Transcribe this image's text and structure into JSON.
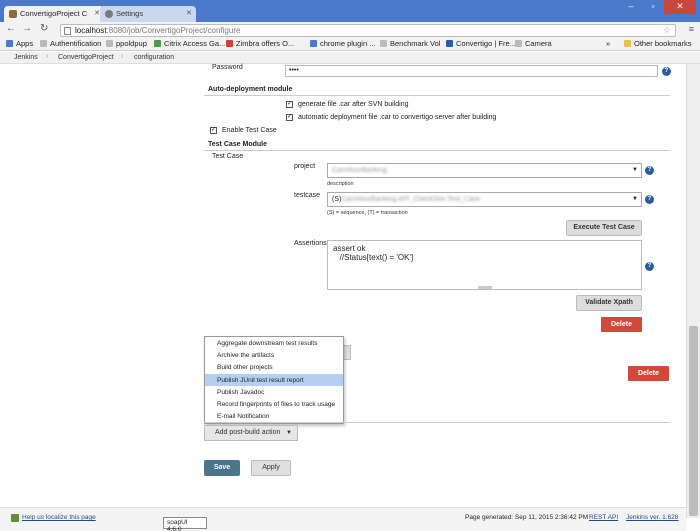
{
  "browser": {
    "tabs": [
      {
        "label": "ConvertigoProject C",
        "active": true
      },
      {
        "label": "Settings",
        "active": false
      }
    ],
    "address": {
      "host": "localhost",
      "path": ":8080/job/ConvertigoProject/configure"
    },
    "bookmarks": [
      {
        "label": "Apps",
        "color": "#4a7bd0"
      },
      {
        "label": "Authentification",
        "color": "#999999"
      },
      {
        "label": "ppoldpup",
        "color": "#999999"
      },
      {
        "label": "Citrix Access Ga...",
        "color": "#4b9a4b"
      },
      {
        "label": "Zimbra offers O...",
        "color": "#d04030"
      },
      {
        "label": "chrome plugin ...",
        "color": "#4a7bd0"
      },
      {
        "label": "Benchmark Vol",
        "color": "#999999"
      },
      {
        "label": "Convertigo | Fre...",
        "color": "#2a5ca8"
      },
      {
        "label": "Camera",
        "color": "#999999"
      }
    ],
    "bookmarks_more": "»",
    "other_bookmarks": "Other bookmarks"
  },
  "breadcrumbs": [
    "Jenkins",
    "ConvertigoProject",
    "configuration"
  ],
  "form": {
    "password_label": "Password",
    "password_value": "••••",
    "auto_deploy_heading": "Auto-deployment module",
    "generate_car": "generate file .car after SVN building",
    "auto_deploy_car": "automatic deployment file .car to convertigo server after building",
    "enable_test_case": "Enable Test Case",
    "test_case_module_heading": "Test Case Module",
    "test_case_label": "Test Case",
    "project_label": "project",
    "project_value": "CarrefourBanking",
    "description_label": "description",
    "testcase_label": "testcase",
    "testcase_value_prefix": "(S)",
    "testcase_value_rest": "CarrefourBanking.API_CheckSite.Test_Case",
    "testcase_hint": "(S) = sequence, (T) = transaction",
    "execute_button": "Execute Test Case",
    "assertions_label": "Assertions",
    "assertions_lines": [
      "assert ok",
      "   //Status[text() = 'OK']"
    ],
    "validate_button": "Validate Xpath",
    "delete_button_1": "Delete",
    "delete_button_2": "Delete"
  },
  "post_build_menu": {
    "items": [
      "Aggregate downstream test results",
      "Archive the artifacts",
      "Build other projects",
      "Publish JUnit test result report",
      "Publish Javadoc",
      "Record fingerprints of files to track usage",
      "E-mail Notification"
    ],
    "highlighted_index": 3,
    "button_label": "Add post-build action"
  },
  "actions": {
    "save": "Save",
    "apply": "Apply"
  },
  "footer": {
    "localize": "Help us localize this page",
    "generated": "Page generated: Sep 11, 2015 2:36:42 PM",
    "rest_api": "REST API",
    "version": "Jenkins ver. 1.628"
  },
  "status_tooltip": "soapUI 4.6.0",
  "colors": {
    "delete": "#d24939",
    "save": "#4b758b",
    "help": "#2a5c9c",
    "menu_highlight": "#b6cef0"
  }
}
